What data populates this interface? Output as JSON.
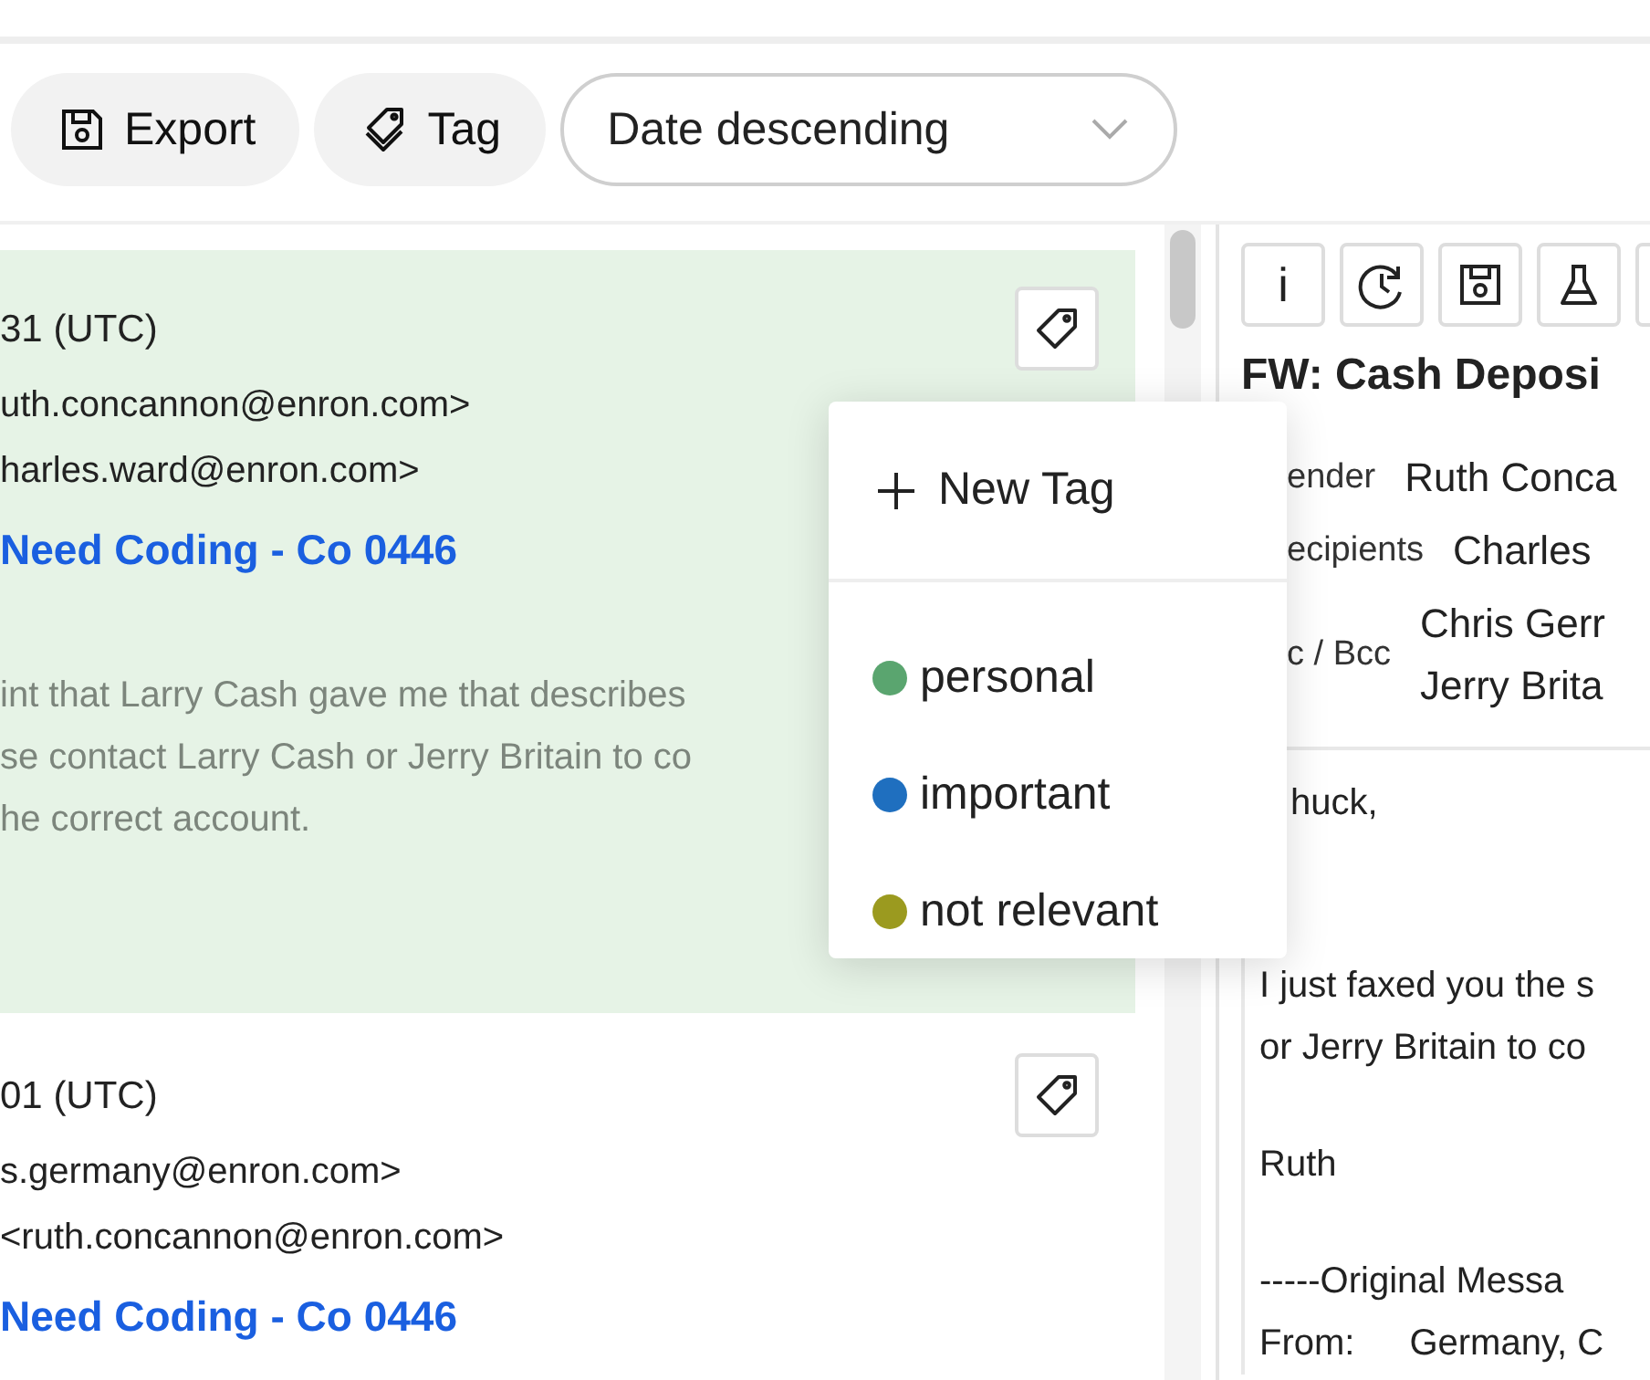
{
  "toolbar": {
    "buttons": [
      {
        "label": "Export",
        "kind": "save"
      },
      {
        "label": "Tag",
        "kind": "tags"
      }
    ],
    "sort_select": {
      "value": "Date descending"
    }
  },
  "messages": [
    {
      "selected": true,
      "date": "31 (UTC)",
      "from": "uth.concannon@enron.com>",
      "to": "harles.ward@enron.com>",
      "subject": "Need Coding - Co 0446",
      "preview": [
        "int that Larry Cash gave me that describes",
        "se contact Larry Cash or Jerry Britain to co",
        "he correct account."
      ]
    },
    {
      "selected": false,
      "date": "01 (UTC)",
      "from": "s.germany@enron.com>",
      "to": "<ruth.concannon@enron.com>",
      "subject": "Need Coding - Co 0446"
    }
  ],
  "tag_menu": {
    "new_tag": "New Tag",
    "tags": [
      {
        "label": "personal",
        "color": "#5aa56f"
      },
      {
        "label": "important",
        "color": "#1f6fbf"
      },
      {
        "label": "not relevant",
        "color": "#9b9a1f"
      }
    ]
  },
  "detail": {
    "tools": [
      {
        "kind": "text",
        "label": "i"
      },
      {
        "kind": "history"
      },
      {
        "kind": "save"
      },
      {
        "kind": "flask"
      },
      {
        "kind": "blank"
      }
    ],
    "subject": "FW: Cash Deposi",
    "fields": [
      {
        "label": "ender",
        "values": [
          "Ruth Conca"
        ]
      },
      {
        "label": "ecipients",
        "values": [
          "Charles"
        ]
      },
      {
        "label": "c / Bcc",
        "values": [
          "Chris Gerr",
          "Jerry Brita"
        ]
      }
    ],
    "body": [
      [
        "huck,"
      ],
      [
        "I just faxed you the s",
        "or Jerry Britain to co"
      ],
      [
        "Ruth"
      ],
      [
        "-----Original Messa"
      ]
    ],
    "header_rows": [
      {
        "label": "From:",
        "value": "Germany, C"
      }
    ]
  }
}
